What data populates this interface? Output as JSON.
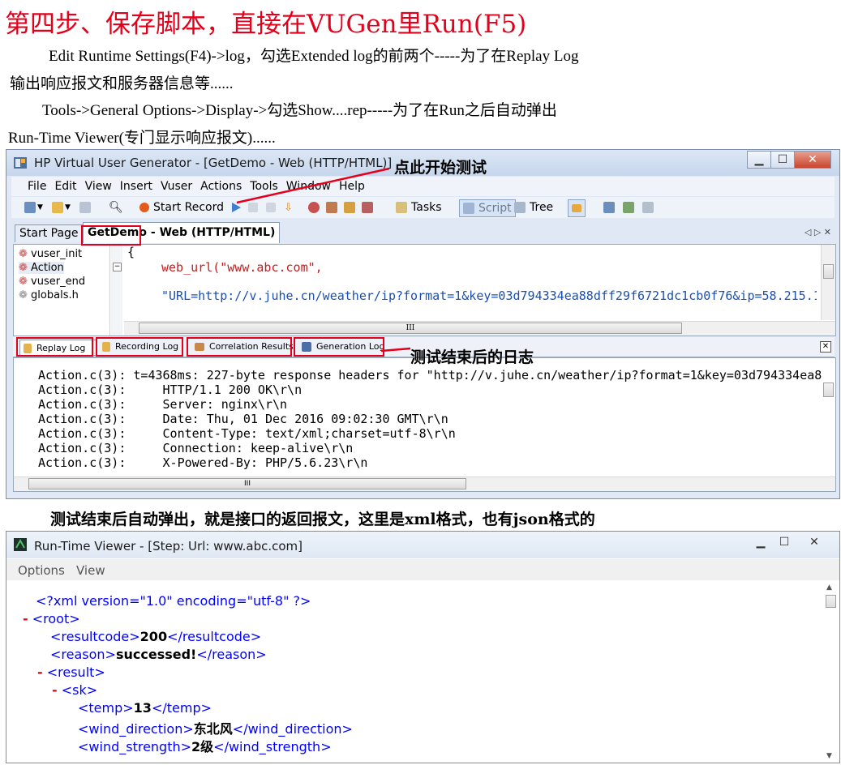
{
  "doc": {
    "heading": "第四步、保存脚本，直接在VUGen里Run(F5)",
    "para1_line1": "Edit Runtime Settings(F4)->log，勾选Extended log的前两个-----为了在Replay Log",
    "para1_line2": "输出响应报文和服务器信息等......",
    "para2_line1": "Tools->General Options->Display->勾选Show....rep-----为了在Run之后自动弹出",
    "para2_line2": "Run-Time Viewer(专门显示响应报文)......",
    "caption2": "测试结束后自动弹出，就是接口的返回报文，这里是xml格式，也有json格式的"
  },
  "annotations": {
    "start_test": "点此开始测试",
    "logs_after": "测试结束后的日志"
  },
  "vugen": {
    "title": "HP Virtual User Generator - [GetDemo - Web (HTTP/HTML)]",
    "menu": [
      "File",
      "Edit",
      "View",
      "Insert",
      "Vuser",
      "Actions",
      "Tools",
      "Window",
      "Help"
    ],
    "toolbar": {
      "start_record": "Start Record",
      "tasks": "Tasks",
      "script": "Script",
      "tree": "Tree"
    },
    "tabs": {
      "start_page": "Start Page",
      "script_name": "GetDemo",
      "script_type": " - Web (HTTP/HTML)"
    },
    "tree": [
      "vuser_init",
      "Action",
      "vuser_end",
      "globals.h"
    ],
    "code": {
      "brace": "{",
      "line1": "web_url(\"www.abc.com\",",
      "line2": "\"URL=http://v.juhe.cn/weather/ip?format=1&key=03d794334ea88dff29f6721dc1cb0f76&ip=58.215.1"
    },
    "output_tabs": [
      "Replay Log",
      "Recording Log",
      "Correlation Results",
      "Generation Log"
    ],
    "log_lines": [
      "Action.c(3): t=4368ms: 227-byte response headers for \"http://v.juhe.cn/weather/ip?format=1&key=03d794334ea8",
      "Action.c(3):     HTTP/1.1 200 OK\\r\\n",
      "Action.c(3):     Server: nginx\\r\\n",
      "Action.c(3):     Date: Thu, 01 Dec 2016 09:02:30 GMT\\r\\n",
      "Action.c(3):     Content-Type: text/xml;charset=utf-8\\r\\n",
      "Action.c(3):     Connection: keep-alive\\r\\n",
      "Action.c(3):     X-Powered-By: PHP/5.6.23\\r\\n"
    ],
    "scroll_mark": "III"
  },
  "viewer": {
    "title": "Run-Time Viewer - [Step: Url: www.abc.com]",
    "menu": [
      "Options",
      "View"
    ],
    "xml": {
      "decl": "<?xml version=\"1.0\" encoding=\"utf-8\" ?>",
      "root_open": "<root>",
      "resultcode_open": "<resultcode>",
      "resultcode_val": "200",
      "resultcode_close": "</resultcode>",
      "reason_open": "<reason>",
      "reason_val": "successed!",
      "reason_close": "</reason>",
      "result_open": "<result>",
      "sk_open": "<sk>",
      "temp_open": "<temp>",
      "temp_val": "13",
      "temp_close": "</temp>",
      "wd_open": "<wind_direction>",
      "wd_val": "东北风",
      "wd_close": "</wind_direction>",
      "ws_open": "<wind_strength>",
      "ws_val": "2级",
      "ws_close": "</wind_strength>",
      "minus": "-"
    }
  },
  "colors": {
    "red": "#e4001b",
    "xml_tag": "#0000ff",
    "title_bg": "#c6d6ec"
  }
}
